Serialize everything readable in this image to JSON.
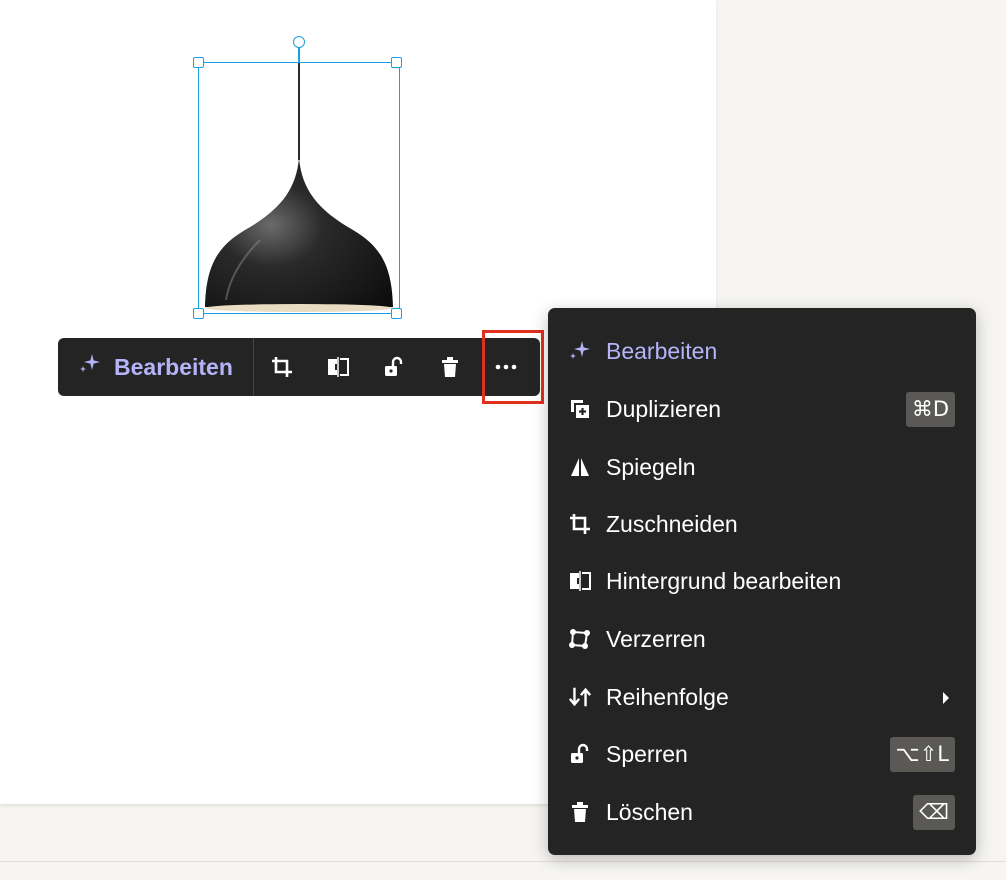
{
  "toolbar": {
    "edit_label": "Bearbeiten",
    "icons": [
      "crop-icon",
      "remove-background-icon",
      "lock-icon",
      "trash-icon",
      "more-icon"
    ]
  },
  "menu": {
    "items": [
      {
        "label": "Bearbeiten",
        "icon": "sparkle-icon",
        "shortcut": ""
      },
      {
        "label": "Duplizieren",
        "icon": "duplicate-icon",
        "shortcut": "⌘D"
      },
      {
        "label": "Spiegeln",
        "icon": "flip-icon",
        "shortcut": ""
      },
      {
        "label": "Zuschneiden",
        "icon": "crop-icon",
        "shortcut": ""
      },
      {
        "label": "Hintergrund bearbeiten",
        "icon": "remove-background-icon",
        "shortcut": ""
      },
      {
        "label": "Verzerren",
        "icon": "distort-icon",
        "shortcut": ""
      },
      {
        "label": "Reihenfolge",
        "icon": "order-icon",
        "shortcut": ""
      },
      {
        "label": "Sperren",
        "icon": "lock-icon",
        "shortcut": "⌥⇧L"
      },
      {
        "label": "Löschen",
        "icon": "trash-icon",
        "shortcut": "⌫"
      }
    ]
  },
  "colors": {
    "accent": "#b6b4f8",
    "selection": "#1aa0e0",
    "highlight": "#e0301e",
    "dark_surface": "#242424"
  }
}
